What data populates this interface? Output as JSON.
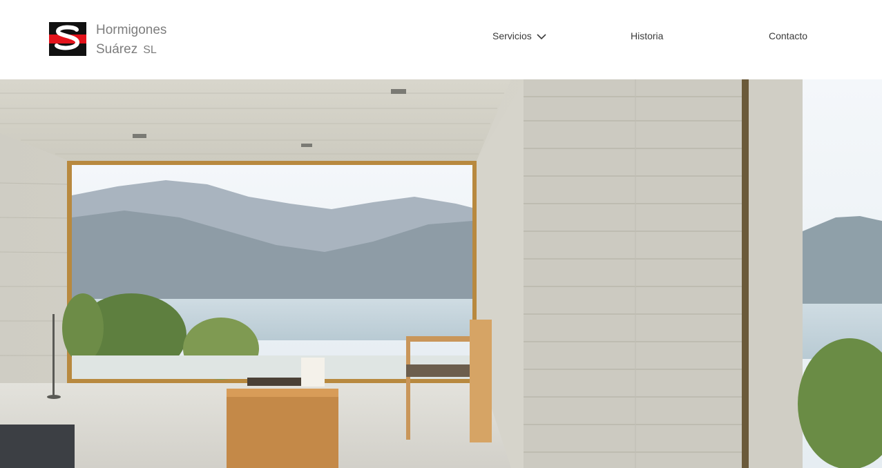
{
  "brand": {
    "name_line1": "Hormigones",
    "name_line2": "Suárez",
    "name_suffix": "SL",
    "logo_letter": "S",
    "colors": {
      "red": "#e3131b",
      "black": "#111111",
      "text": "#7d7d7d"
    }
  },
  "nav": {
    "items": [
      {
        "label": "Servicios",
        "has_dropdown": true,
        "icon": "chevron-down-icon"
      },
      {
        "label": "Historia",
        "has_dropdown": false
      },
      {
        "label": "Contacto",
        "has_dropdown": false
      }
    ]
  },
  "hero": {
    "image": "concrete-interior-lake-view"
  }
}
